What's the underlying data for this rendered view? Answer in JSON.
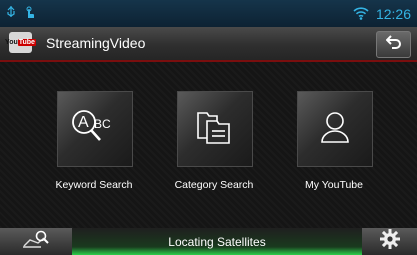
{
  "statusbar": {
    "time": "12:26",
    "icons": [
      "usb-icon",
      "touch-icon",
      "wifi-icon"
    ]
  },
  "header": {
    "app_icon_text": "You",
    "app_icon_text2": "Tube",
    "title": "StreamingVideo",
    "back_icon": "back-arrow-icon"
  },
  "tiles": [
    {
      "label": "Keyword Search",
      "icon": "abc-search-icon",
      "icon_text": "A BC"
    },
    {
      "label": "Category Search",
      "icon": "folder-list-icon"
    },
    {
      "label": "My YouTube",
      "icon": "person-icon"
    }
  ],
  "footer": {
    "status": "Locating Satellites",
    "left_icon": "map-search-icon",
    "right_icon": "gear-icon"
  },
  "colors": {
    "accent": "#34b4e4",
    "header_border": "#7a0e0e",
    "status_glow": "#2bd04a"
  }
}
